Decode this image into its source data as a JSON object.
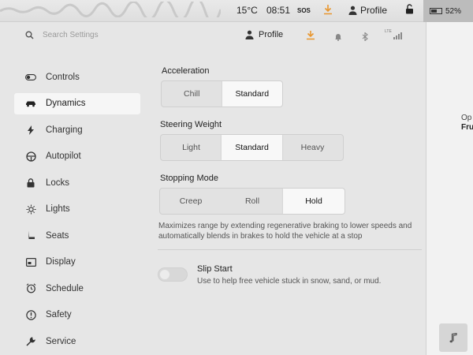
{
  "status_bar": {
    "temperature": "15°C",
    "time": "08:51",
    "sos": "SOS",
    "profile_label": "Profile",
    "battery": "52%"
  },
  "top_bar": {
    "search_placeholder": "Search Settings",
    "profile_label": "Profile",
    "signal_label": "LTE"
  },
  "sidebar": {
    "items": [
      {
        "label": "Controls",
        "icon": "toggle-icon"
      },
      {
        "label": "Dynamics",
        "icon": "car-icon",
        "active": true
      },
      {
        "label": "Charging",
        "icon": "bolt-icon"
      },
      {
        "label": "Autopilot",
        "icon": "steering-wheel-icon"
      },
      {
        "label": "Locks",
        "icon": "lock-icon"
      },
      {
        "label": "Lights",
        "icon": "sun-icon"
      },
      {
        "label": "Seats",
        "icon": "seat-icon"
      },
      {
        "label": "Display",
        "icon": "display-icon"
      },
      {
        "label": "Schedule",
        "icon": "alarm-clock-icon"
      },
      {
        "label": "Safety",
        "icon": "alert-circle-icon"
      },
      {
        "label": "Service",
        "icon": "wrench-icon"
      }
    ]
  },
  "dynamics": {
    "acceleration": {
      "title": "Acceleration",
      "options": [
        "Chill",
        "Standard"
      ],
      "selected": "Standard"
    },
    "steering_weight": {
      "title": "Steering Weight",
      "options": [
        "Light",
        "Standard",
        "Heavy"
      ],
      "selected": "Standard"
    },
    "stopping_mode": {
      "title": "Stopping Mode",
      "options": [
        "Creep",
        "Roll",
        "Hold"
      ],
      "selected": "Hold",
      "description": "Maximizes range by extending regenerative braking to lower speeds and automatically blends in brakes to hold the vehicle at a stop"
    },
    "slip_start": {
      "title": "Slip Start",
      "description": "Use to help free vehicle stuck in snow, sand, or mud.",
      "enabled": false
    }
  },
  "right_pane": {
    "line1": "Op",
    "line2": "Fru"
  },
  "colors": {
    "accent_orange": "#e8962e",
    "panel_bg": "#e6e6e6",
    "selected_bg": "#f8f8f8"
  }
}
